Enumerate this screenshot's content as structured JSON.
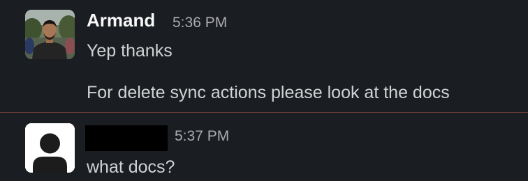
{
  "messages": [
    {
      "author": "Armand",
      "time": "5:36 PM",
      "lines": [
        "Yep thanks",
        "For delete sync actions please look at the docs"
      ],
      "avatar": "photo-avatar"
    },
    {
      "author": "",
      "time": "5:37 PM",
      "lines": [
        "what docs?"
      ],
      "avatar": "default-user-avatar"
    }
  ],
  "colors": {
    "background": "#1a1d21",
    "divider": "#6e3a3a",
    "name": "#f8f8f8",
    "timestamp": "#ababad",
    "body_text": "#d1d2d3"
  }
}
